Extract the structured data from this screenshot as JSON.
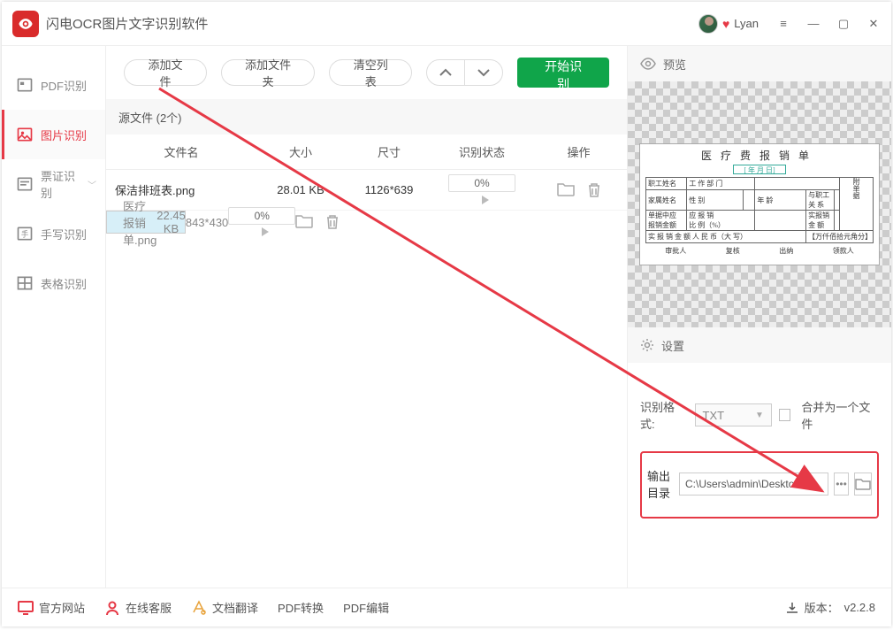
{
  "title": "闪电OCR图片文字识别软件",
  "user": {
    "name": "Lyan"
  },
  "sidebar": [
    {
      "label": "PDF识别",
      "id": "pdf",
      "chev": false
    },
    {
      "label": "图片识别",
      "id": "image",
      "chev": false
    },
    {
      "label": "票证识别",
      "id": "ticket",
      "chev": true
    },
    {
      "label": "手写识别",
      "id": "handwrite",
      "chev": false
    },
    {
      "label": "表格识别",
      "id": "table",
      "chev": false
    }
  ],
  "toolbar": {
    "add_file": "添加文件",
    "add_folder": "添加文件夹",
    "clear": "清空列表",
    "start": "开始识别"
  },
  "source_header": "源文件 (2个)",
  "columns": {
    "name": "文件名",
    "size": "大小",
    "dim": "尺寸",
    "status": "识别状态",
    "op": "操作"
  },
  "files": [
    {
      "name": "保洁排班表.png",
      "size": "28.01 KB",
      "dim": "1126*639",
      "pct": "0%"
    },
    {
      "name": "医疗报销单.png",
      "size": "22.45 KB",
      "dim": "843*430",
      "pct": "0%"
    }
  ],
  "preview": {
    "title": "预览",
    "doc_title": "医疗费报销单",
    "date": "[ 年 月 日]",
    "amount_label": "【万仟佰拾元角分】",
    "foot": [
      "审批人",
      "复核",
      "出纳",
      "领款人"
    ]
  },
  "settings": {
    "title": "设置",
    "format_label": "识别格式:",
    "format_value": "TXT",
    "merge_label": "合并为一个文件",
    "outdir_label": "输出目录",
    "outdir_value": "C:\\Users\\admin\\Deskto"
  },
  "footer": {
    "site": "官方网站",
    "service": "在线客服",
    "translate": "文档翻译",
    "pdfconv": "PDF转换",
    "pdfedit": "PDF编辑",
    "version_label": "版本：",
    "version": "v2.2.8"
  }
}
